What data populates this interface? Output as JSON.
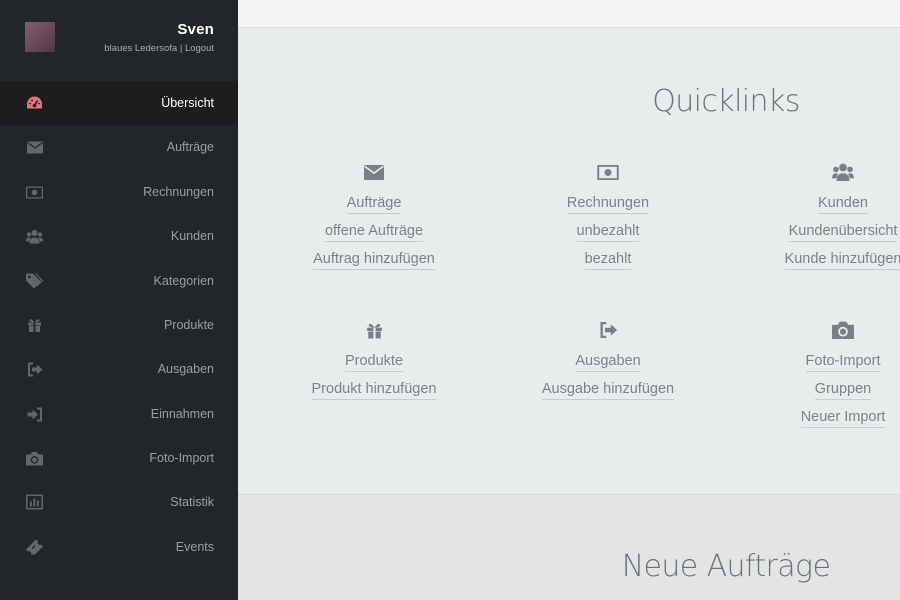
{
  "user": {
    "name": "Sven",
    "subtitle": "blaues Ledersofa",
    "separator": " | ",
    "logout": "Logout"
  },
  "nav": [
    {
      "label": "Übersicht",
      "icon": "dashboard-icon",
      "active": true
    },
    {
      "label": "Aufträge",
      "icon": "envelope-icon"
    },
    {
      "label": "Rechnungen",
      "icon": "money-icon"
    },
    {
      "label": "Kunden",
      "icon": "users-icon"
    },
    {
      "label": "Kategorien",
      "icon": "tags-icon"
    },
    {
      "label": "Produkte",
      "icon": "gift-icon"
    },
    {
      "label": "Ausgaben",
      "icon": "sign-out-icon"
    },
    {
      "label": "Einnahmen",
      "icon": "sign-in-icon"
    },
    {
      "label": "Foto-Import",
      "icon": "camera-icon"
    },
    {
      "label": "Statistik",
      "icon": "bar-chart-icon"
    },
    {
      "label": "Events",
      "icon": "ticket-icon"
    }
  ],
  "quicklinks": {
    "title": "Quicklinks",
    "row1": [
      {
        "icon": "envelope-icon",
        "links": [
          "Aufträge",
          "offene Aufträge",
          "Auftrag hinzufügen"
        ]
      },
      {
        "icon": "money-icon",
        "links": [
          "Rechnungen",
          "unbezahlt",
          "bezahlt"
        ]
      },
      {
        "icon": "users-icon",
        "links": [
          "Kunden",
          "Kundenübersicht",
          "Kunde hinzufügen"
        ]
      }
    ],
    "row2": [
      {
        "icon": "gift-icon",
        "links": [
          "Produkte",
          "Produkt hinzufügen"
        ]
      },
      {
        "icon": "sign-out-icon",
        "links": [
          "Ausgaben",
          "Ausgabe hinzufügen"
        ]
      },
      {
        "icon": "camera-icon",
        "links": [
          "Foto-Import",
          "Gruppen",
          "Neuer Import"
        ]
      }
    ]
  },
  "orders": {
    "title": "Neue Aufträge"
  },
  "colors": {
    "sidebar": "#232628",
    "active_icon": "#e4737c",
    "icon": "#62676a",
    "link": "#7d8285"
  }
}
